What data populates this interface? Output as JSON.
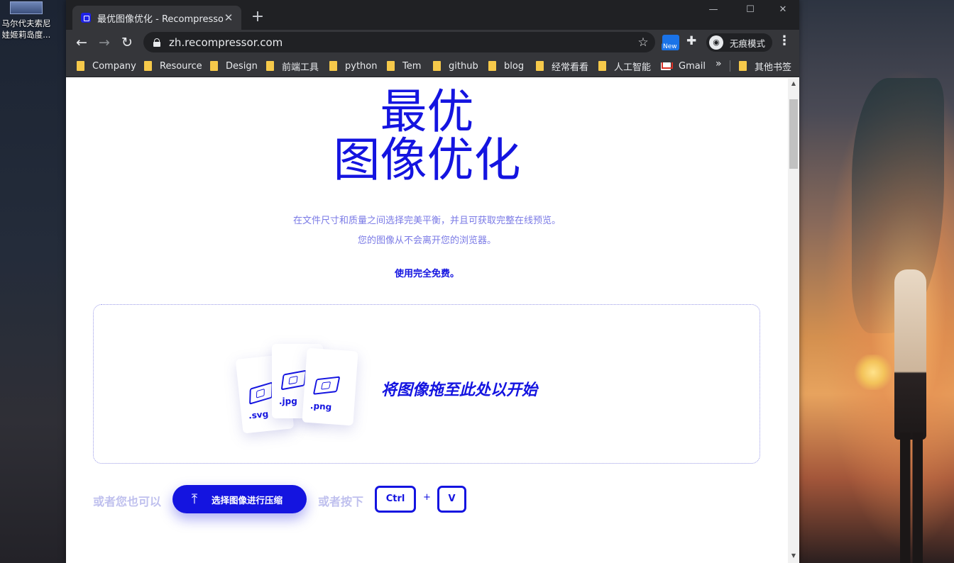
{
  "desktop": {
    "icon_caption": "马尔代夫索尼\n娃姬莉岛度..."
  },
  "browser": {
    "tab": {
      "title": "最优图像优化 - Recompressor",
      "close_glyph": "✕"
    },
    "new_tab_glyph": "+",
    "window_controls": {
      "minimize": "—",
      "maximize": "☐",
      "close": "✕"
    },
    "toolbar": {
      "back_glyph": "←",
      "forward_glyph": "→",
      "reload_glyph": "↻",
      "url": "zh.recompressor.com",
      "star_glyph": "☆",
      "extension_badge": "New",
      "puzzle_glyph": "✚",
      "incognito_label": "无痕模式",
      "incognito_glyph": "◉",
      "menu_glyph": "⋮"
    },
    "bookmarks": [
      {
        "label": "Company",
        "icon": "folder-icon"
      },
      {
        "label": "Resource",
        "icon": "folder-icon"
      },
      {
        "label": "Design",
        "icon": "folder-icon"
      },
      {
        "label": "前端工具",
        "icon": "folder-icon"
      },
      {
        "label": "python",
        "icon": "folder-icon"
      },
      {
        "label": "Tem",
        "icon": "folder-icon"
      },
      {
        "label": "github",
        "icon": "folder-icon"
      },
      {
        "label": "blog",
        "icon": "folder-icon"
      },
      {
        "label": "经常看看",
        "icon": "folder-icon"
      },
      {
        "label": "人工智能",
        "icon": "folder-icon"
      },
      {
        "label": "Gmail",
        "icon": "gmail-icon"
      }
    ],
    "bookmarks_more_glyph": "»",
    "other_bookmarks": "其他书签"
  },
  "page": {
    "hero": {
      "line1": "最优",
      "line2": "图像优化"
    },
    "subtitle": {
      "line1": "在文件尺寸和质量之间选择完美平衡，并且可获取完整在线预览。",
      "line2": "您的图像从不会离开您的浏览器。"
    },
    "free_note": "使用完全免费。",
    "dropzone": {
      "files": [
        ".svg",
        ".jpg",
        ".png"
      ],
      "text": "将图像拖至此处以开始"
    },
    "actions": {
      "or_you_can": "或者您也可以",
      "upload_label": "选择图像进行压缩",
      "upload_glyph": "⤒",
      "or_press": "或者按下",
      "key_ctrl": "Ctrl",
      "plus": "+",
      "key_v": "V"
    }
  },
  "colors": {
    "accent": "#1414e0",
    "muted_accent": "#7a7ae6",
    "chrome_dark": "#202124",
    "chrome_toolbar": "#35363a",
    "folder": "#f6c94a"
  }
}
